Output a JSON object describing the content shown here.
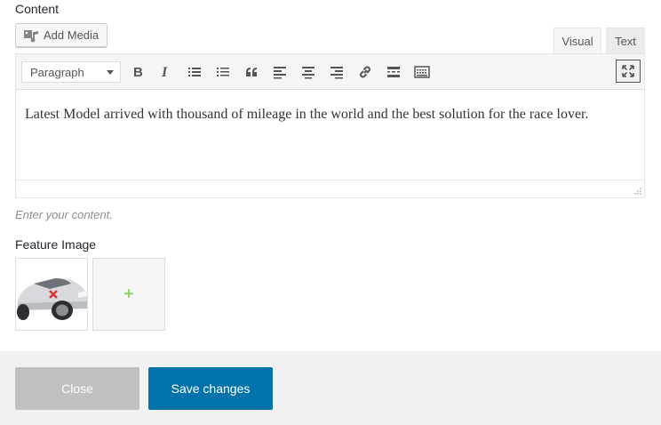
{
  "content_label": "Content",
  "add_media_label": "Add Media",
  "tabs": {
    "visual": "Visual",
    "text": "Text"
  },
  "toolbar": {
    "format_value": "Paragraph",
    "buttons": [
      "bold-icon",
      "italic-icon",
      "bullet-list-icon",
      "numbered-list-icon",
      "blockquote-icon",
      "align-left-icon",
      "align-center-icon",
      "align-right-icon",
      "link-icon",
      "read-more-icon",
      "toolbar-toggle-icon",
      "fullscreen-icon"
    ]
  },
  "editor": {
    "text": "Latest Model arrived with thousand of mileage in the world and the best solution for the race lover."
  },
  "hint": "Enter your content.",
  "feature_image_label": "Feature Image",
  "add_image_symbol": "+",
  "footer": {
    "close_label": "Close",
    "save_label": "Save changes"
  },
  "colors": {
    "primary": "#0073aa",
    "close_bg": "#c0c0c0",
    "plus": "#7ad03a",
    "remove_mark": "#dc3232"
  }
}
